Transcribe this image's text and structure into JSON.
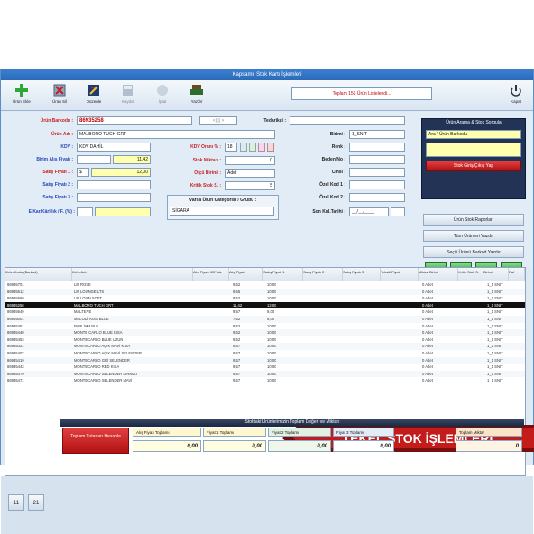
{
  "window": {
    "title": "Kapsamlı Stok Kartı İşlemleri"
  },
  "toolbar": {
    "buttons": [
      {
        "label": "Ürün Ekle",
        "icon": "plus-icon"
      },
      {
        "label": "Ürün Sil",
        "icon": "delete-icon"
      },
      {
        "label": "Düzenle",
        "icon": "edit-icon"
      },
      {
        "label": "Kaydet",
        "icon": "save-icon"
      },
      {
        "label": "İptal",
        "icon": "cancel-icon"
      },
      {
        "label": "Yazdır",
        "icon": "print-icon"
      }
    ],
    "alert": "Toplam 156 Ürün Listelendi...",
    "close_label": "Kapat"
  },
  "form": {
    "barcode_label": "Ürün Barkodu :",
    "barcode_value": "86935258",
    "supplier_label": "Tedarikçi :",
    "supplier_value": "",
    "name_label": "Ürün Adı :",
    "name_value": "MALBORO TUCH GRT",
    "unit_label": "Birimi :",
    "unit_value": "1_SNIT",
    "kdv_label": "KDV :",
    "kdv_value": "KDV DAHİL",
    "kdv_rate_label": "KDV Oranı % :",
    "kdv_rate_value": "18",
    "color_label": "Renk :",
    "buy_label": "Birim Alış Fiyatı :",
    "buy_value": "11,42",
    "size_label": "Beden/No :",
    "sale1_label": "Satış Fiyatı 1 :",
    "sale1_currency": "$",
    "sale1_value": "12,00",
    "stock_label": "Stok Miktarı :",
    "stock_value": "0",
    "model_label": "Cinsi :",
    "unit2_label": "Ölçü Birimi :",
    "unit2_value": "Adet",
    "sale2_label": "Satış Fiyatı 2 :",
    "special1_label": "Özel Kod 1 :",
    "critical_label": "Kritik Stok S. :",
    "critical_value": "5",
    "sale3_label": "Satış Fiyatı 3 :",
    "special2_label": "Özel Kod 2 :",
    "category_label": "Varsa Ürün Kategorisi / Grubu :",
    "category_value": "SİGARA",
    "date_label": "Son Kul.Tarihi :",
    "date_value": "__/__/____",
    "misc_label": "E.Kar/Kârlılık / F. (%) :"
  },
  "panel": {
    "header": "Ürün Arama & Stok Sorgula",
    "search_select": "Ara / Ürün Barkodu",
    "search_button": "Stok Giriş/Çıkış Yap",
    "report_button": "Ürün Stok Raporları",
    "all_button": "Tüm Ürünleri Yazdır",
    "selected_button": "Seçili Ürünü Barkod Yazdır"
  },
  "grid": {
    "columns": [
      "Ürün Kodu (Barkod)",
      "Ürün Adı",
      "Alış Fiyatı KDVsiz",
      "Alış Fiyatı",
      "Satış Fiyatı 1",
      "Satış Fiyatı 2",
      "Satış Fiyatı 3",
      "Tekstil Fiyatı",
      "Miktar Birimi",
      "Kritik Stok S.",
      "Birimi",
      "Raf"
    ],
    "rows": [
      [
        "86935701",
        "LM ROSE",
        "9,52",
        "10,00",
        "0 Adet",
        "1_1 SNIT"
      ],
      [
        "86935512",
        "LM LOUNGE LTS",
        "9,55",
        "10,00",
        "0 Adet",
        "1_1 SNIT"
      ],
      [
        "86935669",
        "LM LOUN SOFT",
        "9,52",
        "10,00",
        "0 Adet",
        "1_1 SNIT"
      ],
      [
        "86935258",
        "MALBORO TUCH GRT",
        "11,42",
        "12,00",
        "0 Adet",
        "1_1 SNIT"
      ],
      [
        "86935649",
        "MALTEPE",
        "9,57",
        "8,00",
        "0 Adet",
        "1_1 SNIT"
      ],
      [
        "86905001",
        "MELODİ KISA BLUE",
        "7,62",
        "8,00",
        "0 Adet",
        "1_1 SNIT"
      ],
      [
        "86935451",
        "PARLİAM BLU",
        "9,52",
        "10,00",
        "0 Adet",
        "1_1 SNIT"
      ],
      [
        "86935440",
        "MONTE CARLO BLUE KISA",
        "9,52",
        "10,00",
        "0 Adet",
        "1_1 SNIT"
      ],
      [
        "86935453",
        "MONTECARLO BLUE UZUN",
        "9,52",
        "10,00",
        "0 Adet",
        "1_1 SNIT"
      ],
      [
        "86935421",
        "MONTECARLO AÇIK MAVİ KISA",
        "9,57",
        "10,00",
        "0 Adet",
        "1_1 SNIT"
      ],
      [
        "86935407",
        "MONTECARLO AÇIK MAVİ SELENDER",
        "9,57",
        "10,00",
        "0 Adet",
        "1_1 SNIT"
      ],
      [
        "86935419",
        "MONTECARLO GRİ SELENDER",
        "9,57",
        "10,00",
        "0 Adet",
        "1_1 SNIT"
      ],
      [
        "86935443",
        "MONTECARLO RED KISA",
        "9,57",
        "10,00",
        "0 Adet",
        "1_1 SNIT"
      ],
      [
        "86935470",
        "MONTECARLO SELENDER KIRMIZI",
        "9,57",
        "10,00",
        "0 Adet",
        "1_1 SNIT"
      ],
      [
        "86935471",
        "MONTECARLO SELENDER MAVİ",
        "9,57",
        "10,00",
        "0 Adet",
        "1_1 SNIT"
      ]
    ]
  },
  "banner": {
    "text": "TEKEL STOK İŞLEMLERİ"
  },
  "bottom": {
    "title": "Stoktaki Ürünlerimizin Toplam Değeri ve Miktarı",
    "total_button": "Toplam Tutarları Hesapla",
    "cols": [
      {
        "label": "Alış Fiyatı Toplamı",
        "value": "0,00"
      },
      {
        "label": "Fiyat 1 Toplamı",
        "value": "0,00"
      },
      {
        "label": "Fiyat 2 Toplamı",
        "value": "0,00"
      },
      {
        "label": "Fiyat 3 Toplamı",
        "value": "0,00"
      },
      {
        "label": "Toplam Miktar",
        "value": "0"
      }
    ]
  }
}
